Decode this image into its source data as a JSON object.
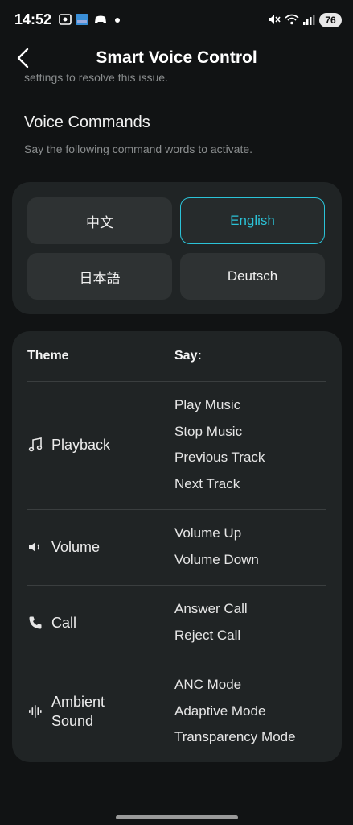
{
  "status_bar": {
    "time": "14:52",
    "battery": "76"
  },
  "header": {
    "title": "Smart Voice Control",
    "clipped_text": "settings to resolve this issue."
  },
  "voice_commands": {
    "title": "Voice Commands",
    "subtitle": "Say the following command words to activate."
  },
  "languages": [
    {
      "label": "中文",
      "selected": false
    },
    {
      "label": "English",
      "selected": true
    },
    {
      "label": "日本語",
      "selected": false
    },
    {
      "label": "Deutsch",
      "selected": false
    }
  ],
  "table": {
    "theme_header": "Theme",
    "say_header": "Say:",
    "rows": [
      {
        "theme": "Playback",
        "icon": "music-note-icon",
        "commands": [
          "Play Music",
          "Stop Music",
          "Previous Track",
          "Next Track"
        ]
      },
      {
        "theme": "Volume",
        "icon": "speaker-icon",
        "commands": [
          "Volume Up",
          "Volume Down"
        ]
      },
      {
        "theme": "Call",
        "icon": "phone-icon",
        "commands": [
          "Answer Call",
          "Reject Call"
        ]
      },
      {
        "theme": "Ambient\nSound",
        "icon": "sound-wave-icon",
        "commands": [
          "ANC Mode",
          "Adaptive Mode",
          "Transparency Mode"
        ]
      }
    ]
  },
  "colors": {
    "accent": "#2bc3d8",
    "background": "#111314",
    "panel": "#202425"
  }
}
